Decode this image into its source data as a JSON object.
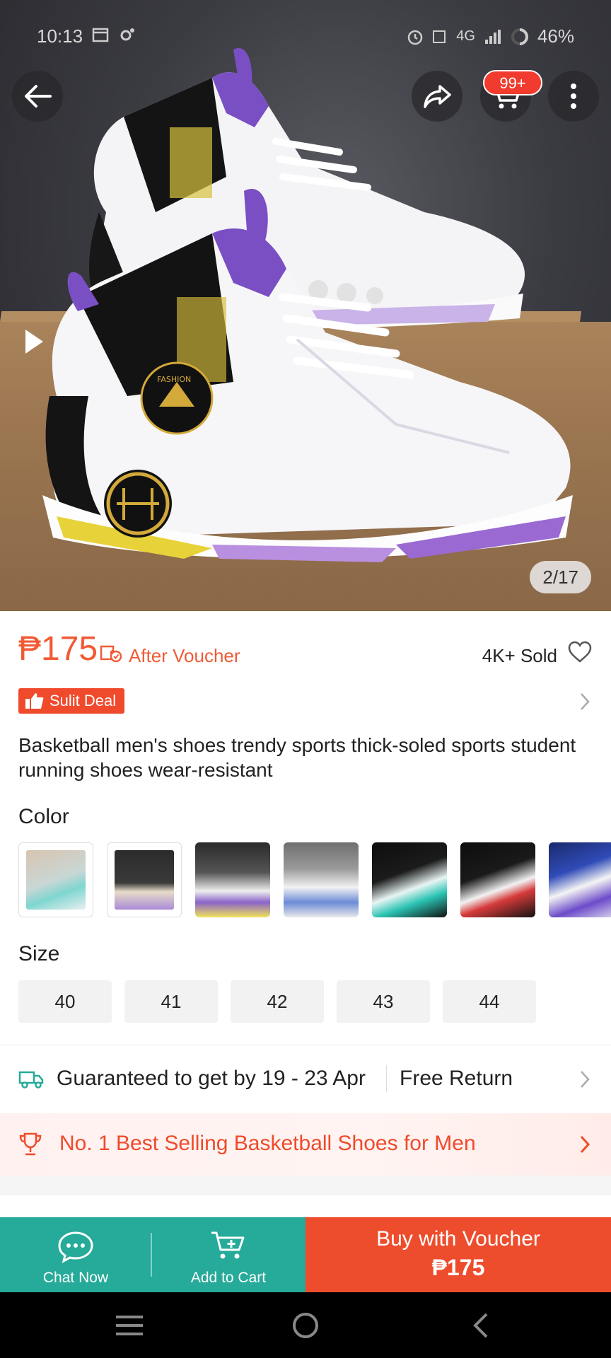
{
  "status_bar": {
    "time": "10:13",
    "network": "4G",
    "battery": "46%"
  },
  "hero": {
    "image_counter": "2/17",
    "cart_badge": "99+",
    "shoe_text": "FASHION",
    "back_icon": "arrow-left-icon",
    "share_icon": "share-icon",
    "cart_icon": "cart-icon",
    "more_icon": "more-vertical-icon",
    "play_icon": "play-icon"
  },
  "product": {
    "price": "₱175",
    "after_voucher": "After Voucher",
    "sold": "4K+ Sold",
    "sulit_deal": "Sulit Deal",
    "title": "Basketball men's shoes trendy sports thick-soled sports student running shoes wear-resistant",
    "color_label": "Color",
    "size_label": "Size",
    "sizes": [
      "40",
      "41",
      "42",
      "43",
      "44"
    ]
  },
  "shipping": {
    "guarantee": "Guaranteed to get by 19 - 23 Apr",
    "free_return": "Free Return"
  },
  "ranking": {
    "text": "No. 1 Best Selling Basketball Shoes for Men"
  },
  "actions": {
    "chat_now": "Chat Now",
    "add_to_cart": "Add to Cart",
    "buy_line1": "Buy with Voucher",
    "buy_price": "₱175"
  },
  "colors": {
    "accent": "#ee4d2d",
    "teal": "#26aa99"
  }
}
